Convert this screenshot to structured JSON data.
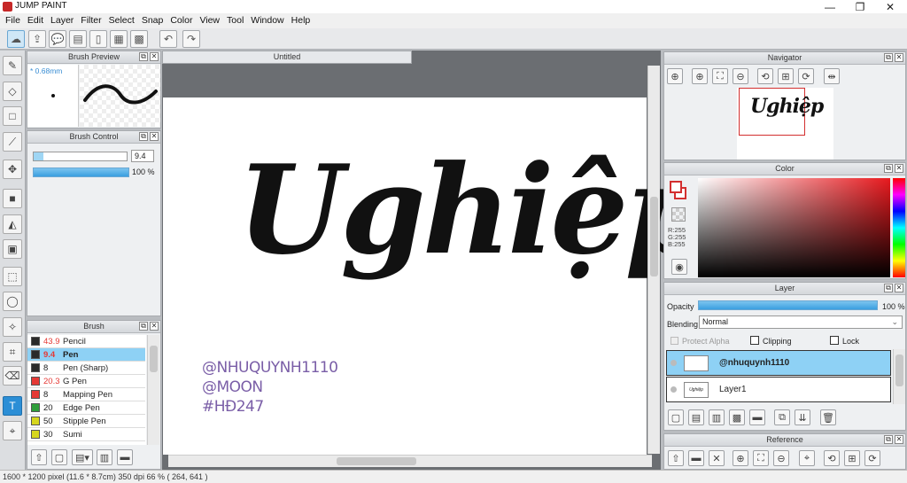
{
  "window": {
    "title": "JUMP PAINT",
    "controls": {
      "minimize": "—",
      "maximize": "❐",
      "close": "✕"
    }
  },
  "menu": [
    "File",
    "Edit",
    "Layer",
    "Filter",
    "Select",
    "Snap",
    "Color",
    "View",
    "Tool",
    "Window",
    "Help"
  ],
  "document": {
    "tab": "Untitled"
  },
  "brush_preview": {
    "title": "Brush Preview",
    "size_label": "* 0.68mm"
  },
  "brush_control": {
    "title": "Brush Control",
    "size_value": "9.4",
    "opacity_value": "100 %",
    "opacity_fraction": 1.0,
    "size_fraction": 0.1
  },
  "brush": {
    "title": "Brush",
    "items": [
      {
        "size": "43.9",
        "name": "Pencil",
        "color": "#2a2a2a",
        "size_color": "#e53935",
        "selected": false
      },
      {
        "size": "9.4",
        "name": "Pen",
        "color": "#2a2a2a",
        "size_color": "#e53935",
        "selected": true
      },
      {
        "size": "8",
        "name": "Pen (Sharp)",
        "color": "#2a2a2a",
        "size_color": "#222222",
        "selected": false
      },
      {
        "size": "20.3",
        "name": "G Pen",
        "color": "#e53935",
        "size_color": "#e53935",
        "selected": false
      },
      {
        "size": "8",
        "name": "Mapping Pen",
        "color": "#e53935",
        "size_color": "#222222",
        "selected": false
      },
      {
        "size": "20",
        "name": "Edge Pen",
        "color": "#2e9e3a",
        "size_color": "#222222",
        "selected": false
      },
      {
        "size": "50",
        "name": "Stipple Pen",
        "color": "#d6d61e",
        "size_color": "#222222",
        "selected": false
      },
      {
        "size": "30",
        "name": "Sumi",
        "color": "#d6d61e",
        "size_color": "#222222",
        "selected": false
      }
    ]
  },
  "canvas": {
    "artwork_text": "Ughiệp",
    "watermark_lines": [
      "@NHUQUYNH1110",
      "@MOON",
      "#HĐ247"
    ],
    "watermark_color": "#7a5ea7"
  },
  "navigator": {
    "title": "Navigator",
    "thumb_text": "Ughiệp"
  },
  "color_panel": {
    "title": "Color",
    "rgb": [
      "R:255",
      "G:255",
      "B:255"
    ]
  },
  "layer_panel": {
    "title": "Layer",
    "opacity_label": "Opacity",
    "opacity_value": "100 %",
    "opacity_fraction": 1.0,
    "blending_label": "Blending",
    "blending_value": "Normal",
    "protect_alpha": "Protect Alpha",
    "clipping": "Clipping",
    "lock": "Lock",
    "layers": [
      {
        "name": "@nhuquynh1110",
        "selected": true,
        "thumb": ""
      },
      {
        "name": "Layer1",
        "selected": false,
        "thumb": "Ughiệp"
      }
    ]
  },
  "reference": {
    "title": "Reference"
  },
  "status": {
    "text": "1600 * 1200 pixel   (11.6 * 8.7cm)   350 dpi   66 %   ( 264, 641 )"
  }
}
